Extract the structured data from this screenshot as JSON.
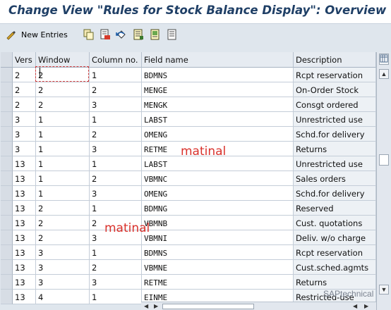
{
  "title": "Change View \"Rules for Stock Balance Display\": Overview",
  "toolbar": {
    "new_entries_label": "New Entries",
    "icons": [
      "edit-glasses-icon",
      "copy-icon",
      "delete-icon",
      "undo-icon",
      "select-all-icon",
      "select-block-icon",
      "deselect-all-icon"
    ]
  },
  "table": {
    "headers": {
      "vers": "Vers",
      "window": "Window",
      "column": "Column no.",
      "field": "Field name",
      "description": "Description"
    },
    "rows": [
      {
        "vers": "2",
        "window": "2",
        "column": "1",
        "field": "BDMNS",
        "description": "Rcpt reservation"
      },
      {
        "vers": "2",
        "window": "2",
        "column": "2",
        "field": "MENGE",
        "description": "On-Order Stock"
      },
      {
        "vers": "2",
        "window": "2",
        "column": "3",
        "field": "MENGK",
        "description": "Consgt ordered"
      },
      {
        "vers": "3",
        "window": "1",
        "column": "1",
        "field": "LABST",
        "description": "Unrestricted use"
      },
      {
        "vers": "3",
        "window": "1",
        "column": "2",
        "field": "OMENG",
        "description": "Schd.for delivery"
      },
      {
        "vers": "3",
        "window": "1",
        "column": "3",
        "field": "RETME",
        "description": "Returns"
      },
      {
        "vers": "13",
        "window": "1",
        "column": "1",
        "field": "LABST",
        "description": "Unrestricted use"
      },
      {
        "vers": "13",
        "window": "1",
        "column": "2",
        "field": "VBMNC",
        "description": "Sales orders"
      },
      {
        "vers": "13",
        "window": "1",
        "column": "3",
        "field": "OMENG",
        "description": "Schd.for delivery"
      },
      {
        "vers": "13",
        "window": "2",
        "column": "1",
        "field": "BDMNG",
        "description": "Reserved"
      },
      {
        "vers": "13",
        "window": "2",
        "column": "2",
        "field": "VBMNB",
        "description": "Cust. quotations"
      },
      {
        "vers": "13",
        "window": "2",
        "column": "3",
        "field": "VBMNI",
        "description": "Deliv. w/o charge"
      },
      {
        "vers": "13",
        "window": "3",
        "column": "1",
        "field": "BDMNS",
        "description": "Rcpt reservation"
      },
      {
        "vers": "13",
        "window": "3",
        "column": "2",
        "field": "VBMNE",
        "description": "Cust.sched.agmts"
      },
      {
        "vers": "13",
        "window": "3",
        "column": "3",
        "field": "RETME",
        "description": "Returns"
      },
      {
        "vers": "13",
        "window": "4",
        "column": "1",
        "field": "EINME",
        "description": "Restricted-use"
      }
    ]
  },
  "watermarks": {
    "text1": "matinal",
    "text2": "matinal",
    "corner": "SAPtechnical"
  },
  "colors": {
    "title_text": "#1f3f66",
    "background": "#dfe6ed",
    "watermark_red": "#d9312b"
  }
}
